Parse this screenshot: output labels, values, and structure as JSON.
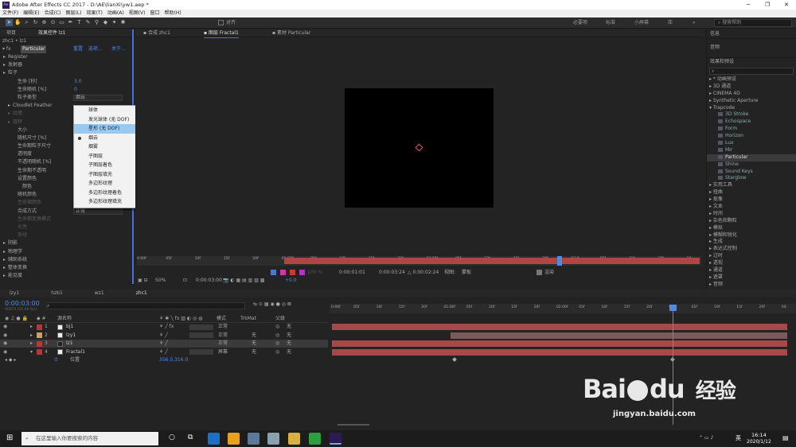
{
  "titlebar": {
    "title": "Adobe After Effects CC 2017 - D:\\AE\\lianXi\\yw1.aep *"
  },
  "menu": [
    "文件(F)",
    "编辑(E)",
    "合成(C)",
    "图层(L)",
    "效果(T)",
    "动画(A)",
    "视图(V)",
    "窗口",
    "帮助(H)"
  ],
  "toolbar": {
    "align_label": "对齐",
    "workspaces": [
      "必要项",
      "标准",
      "小屏幕",
      "库",
      "»"
    ],
    "search_placeholder": "搜索帮助"
  },
  "left_panel": {
    "tabs": [
      "项目",
      "效果控件 lz1"
    ],
    "breadcrumb": "zhc1 • lz1",
    "effect_name": "Particular",
    "effect_links": [
      "重置",
      "选项...",
      "关于..."
    ],
    "props": [
      {
        "label": "Register",
        "indent": 1,
        "dim": false,
        "value": ""
      },
      {
        "label": "发射器",
        "indent": 1,
        "dim": false,
        "value": ""
      },
      {
        "label": "粒子",
        "indent": 1,
        "dim": false,
        "value": ""
      },
      {
        "label": "生命 [秒]",
        "indent": 3,
        "dim": false,
        "value": "3.0"
      },
      {
        "label": "生命随机 [%]",
        "indent": 3,
        "dim": false,
        "value": "0"
      },
      {
        "label": "粒子类型",
        "indent": 3,
        "dim": false,
        "value": "",
        "select": "烟云"
      },
      {
        "label": "Cloudlet Feather",
        "indent": 2,
        "dim": false,
        "value": ""
      },
      {
        "label": "纹理",
        "indent": 2,
        "dim": true,
        "value": ""
      },
      {
        "label": "旋转",
        "indent": 2,
        "dim": true,
        "value": ""
      },
      {
        "label": "大小",
        "indent": 3,
        "dim": false,
        "value": ""
      },
      {
        "label": "随机尺寸 [%]",
        "indent": 3,
        "dim": false,
        "value": ""
      },
      {
        "label": "生命期粒子尺寸",
        "indent": 3,
        "dim": false,
        "value": ""
      },
      {
        "label": "透明度",
        "indent": 3,
        "dim": false,
        "value": ""
      },
      {
        "label": "不透明随机 [%]",
        "indent": 3,
        "dim": false,
        "value": ""
      },
      {
        "label": "生命期不透明",
        "indent": 3,
        "dim": false,
        "value": ""
      },
      {
        "label": "设置颜色",
        "indent": 3,
        "dim": false,
        "value": ""
      },
      {
        "label": "颜色",
        "indent": 4,
        "dim": false,
        "value": ""
      },
      {
        "label": "随机颜色",
        "indent": 3,
        "dim": false,
        "value": ""
      },
      {
        "label": "生命期颜色",
        "indent": 3,
        "dim": true,
        "value": ""
      },
      {
        "label": "合成方式",
        "indent": 3,
        "dim": false,
        "value": "",
        "select": "正常"
      },
      {
        "label": "生命期变换模式",
        "indent": 3,
        "dim": true,
        "value": ""
      },
      {
        "label": "光亮",
        "indent": 3,
        "dim": true,
        "value": ""
      },
      {
        "label": "条纹",
        "indent": 3,
        "dim": true,
        "value": ""
      },
      {
        "label": "阴影",
        "indent": 1,
        "dim": false,
        "value": ""
      },
      {
        "label": "物理学",
        "indent": 1,
        "dim": false,
        "value": ""
      },
      {
        "label": "辅助系统",
        "indent": 1,
        "dim": false,
        "value": ""
      },
      {
        "label": "整体变换",
        "indent": 1,
        "dim": false,
        "value": ""
      },
      {
        "label": "能见度",
        "indent": 1,
        "dim": false,
        "value": ""
      }
    ]
  },
  "dropdown": {
    "items": [
      {
        "label": "球体",
        "state": ""
      },
      {
        "label": "发光球体 (无 DOF)",
        "state": ""
      },
      {
        "label": "星形 (无 DOF)",
        "state": "highlight"
      },
      {
        "label": "烟云",
        "state": "checked"
      },
      {
        "label": "烟雾",
        "state": ""
      },
      {
        "label": "子图层",
        "state": ""
      },
      {
        "label": "子图层着色",
        "state": ""
      },
      {
        "label": "子图层填充",
        "state": ""
      },
      {
        "label": "多边形纹理",
        "state": ""
      },
      {
        "label": "多边形纹理着色",
        "state": ""
      },
      {
        "label": "多边形纹理填充",
        "state": ""
      }
    ]
  },
  "viewer": {
    "tabs": [
      "合成 zhc1",
      "图层 Fractal1",
      "素材 Particular"
    ],
    "ruler_ticks": [
      "0:00f",
      "05f",
      "10f",
      "15f",
      "20f",
      "01:00f",
      "05f",
      "10f",
      "15f",
      "20f",
      "02:00f",
      "05f",
      "10f",
      "15f",
      "20f",
      "03:0",
      "05f",
      "10f",
      "15f",
      "04:"
    ],
    "controls": {
      "timecode_a": "0:00:01:01",
      "timecode_b": "0:00:03:24",
      "duration": "△ 0:00:02:24",
      "view_label": "视图:",
      "view_value": "蒙板",
      "render_label": "渲染",
      "zoom": "50%",
      "timecode": "0:00:03:00",
      "offset": "+0.0",
      "resolution": "100 %"
    },
    "colors": {
      "work_area": "#b04545",
      "playhead": "#4d8be8"
    }
  },
  "right_panel": {
    "sections": [
      "信息",
      "音频",
      "效果和预设"
    ],
    "search_placeholder": "",
    "items": [
      {
        "label": "▸ * 动画预设",
        "type": "cat"
      },
      {
        "label": "▸ 3D 通道",
        "type": "cat"
      },
      {
        "label": "▸ CINEMA 4D",
        "type": "cat"
      },
      {
        "label": "▸ Synthetic Aperture",
        "type": "cat"
      },
      {
        "label": "▾ Trapcode",
        "type": "cat"
      },
      {
        "label": "3D Stroke",
        "type": "sub"
      },
      {
        "label": "Echospace",
        "type": "sub"
      },
      {
        "label": "Form",
        "type": "sub"
      },
      {
        "label": "Horizon",
        "type": "sub"
      },
      {
        "label": "Lux",
        "type": "sub"
      },
      {
        "label": "Mir",
        "type": "sub"
      },
      {
        "label": "Particular",
        "type": "sel"
      },
      {
        "label": "Shine",
        "type": "sub"
      },
      {
        "label": "Sound Keys",
        "type": "sub"
      },
      {
        "label": "Starglow",
        "type": "sub"
      },
      {
        "label": "▸ 实用工具",
        "type": "cat"
      },
      {
        "label": "▸ 扭曲",
        "type": "cat"
      },
      {
        "label": "▸ 抠像",
        "type": "cat"
      },
      {
        "label": "▸ 文本",
        "type": "cat"
      },
      {
        "label": "▸ 时间",
        "type": "cat"
      },
      {
        "label": "▸ 杂色和颗粒",
        "type": "cat"
      },
      {
        "label": "▸ 模拟",
        "type": "cat"
      },
      {
        "label": "▸ 模糊和锐化",
        "type": "cat"
      },
      {
        "label": "▸ 生成",
        "type": "cat"
      },
      {
        "label": "▸ 表达式控制",
        "type": "cat"
      },
      {
        "label": "▸ 过时",
        "type": "cat"
      },
      {
        "label": "▸ 透视",
        "type": "cat"
      },
      {
        "label": "▸ 通道",
        "type": "cat"
      },
      {
        "label": "▸ 遮罩",
        "type": "cat"
      },
      {
        "label": "▸ 音频",
        "type": "cat"
      }
    ]
  },
  "timeline": {
    "tabs": [
      "lzy1",
      "hzb1",
      "wz1",
      "zhc1"
    ],
    "timecode": "0:00:03:00",
    "frames": "00075 (25.00 fps)",
    "col_headers": {
      "name": "源名称",
      "mode": "模式",
      "trkmat": "TrkMat",
      "parent": "父级"
    },
    "layers": [
      {
        "num": "1",
        "name": "bj1",
        "color": "#c8c8c8",
        "swatch": "#b03a3a",
        "mode": "正常",
        "trk": "",
        "parent": "无",
        "bar_start": 0.0,
        "bar_end": 1.0
      },
      {
        "num": "2",
        "name": "lzy1",
        "color": "#c8c8c8",
        "swatch": "#c8a070",
        "mode": "正常",
        "trk": "无",
        "parent": "无",
        "bar_start": 0.26,
        "bar_end": 1.0
      },
      {
        "num": "3",
        "name": "lz1",
        "color": "#c8c8c8",
        "swatch": "#b03a3a",
        "mode": "正常",
        "trk": "无",
        "parent": "无",
        "bar_start": 0.0,
        "bar_end": 1.0
      },
      {
        "num": "4",
        "name": "Fractal1",
        "color": "#c8c8c8",
        "swatch": "#b03a3a",
        "mode": "屏幕",
        "trk": "无",
        "parent": "无",
        "bar_start": 0.0,
        "bar_end": 1.0
      }
    ],
    "sub_prop": {
      "label": "位置",
      "value": "356.0,316.0"
    },
    "ruler_ticks": [
      "0:00f",
      "05f",
      "10f",
      "15f",
      "20f",
      "01:00f",
      "05f",
      "10f",
      "15f",
      "20f",
      "02:00f",
      "05f",
      "10f",
      "15f",
      "20f",
      "03:0",
      "05f",
      "10f",
      "15f",
      "20f",
      "04:"
    ],
    "playhead": 0.755
  },
  "watermark": {
    "brand": "Bai",
    "paw": "du",
    "suffix": "经验",
    "url": "jingyan.baidu.com"
  },
  "taskbar": {
    "search_placeholder": "在这里输入你要搜索的内容",
    "ime": "英",
    "time": "16:14",
    "date": "2020/1/12"
  }
}
